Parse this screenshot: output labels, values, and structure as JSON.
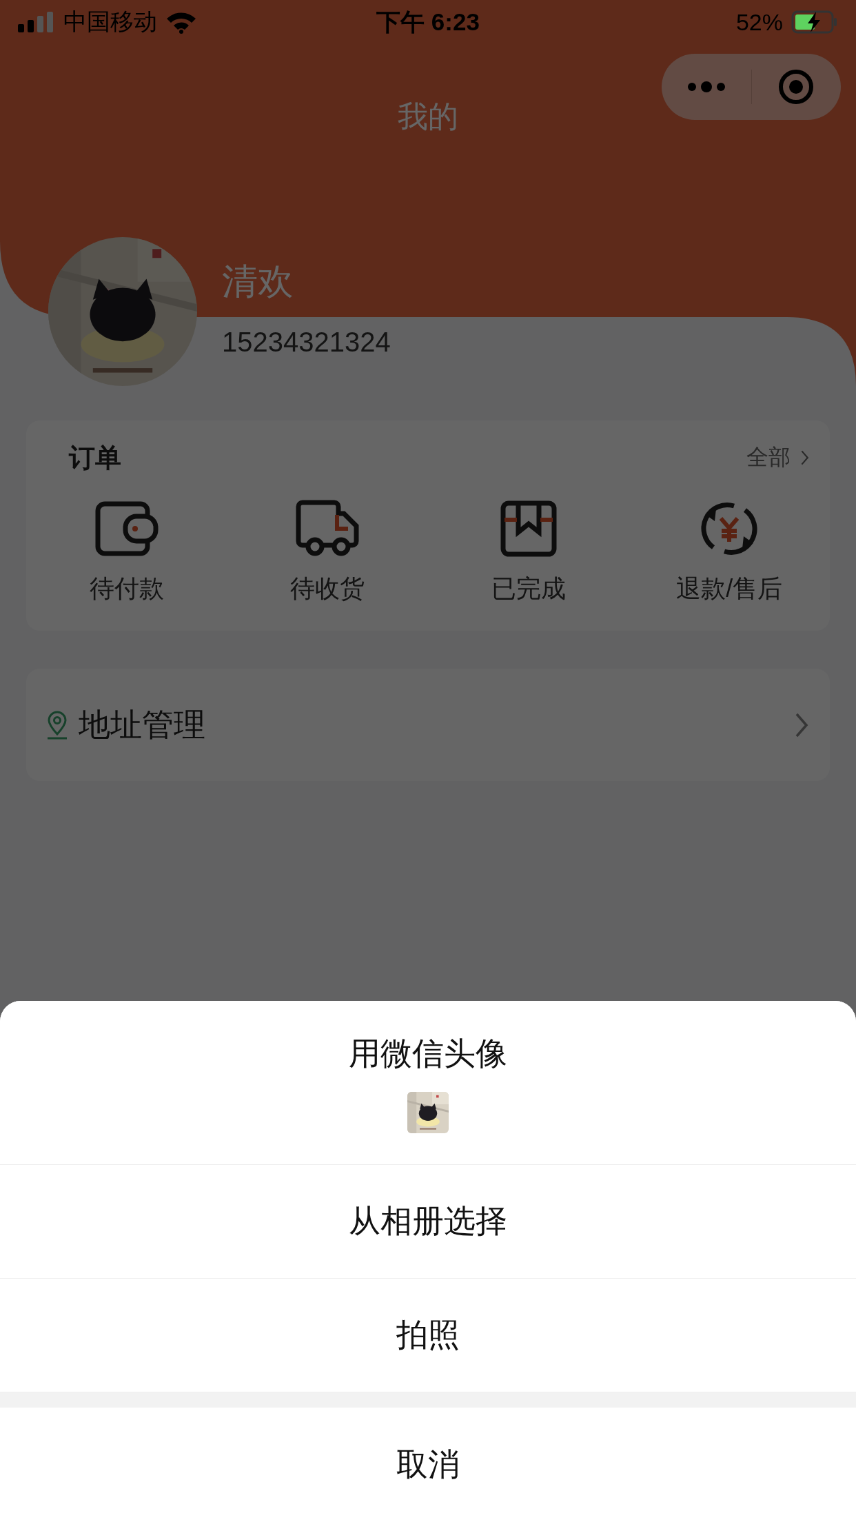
{
  "status_bar": {
    "carrier": "中国移动",
    "time": "下午 6:23",
    "battery": "52%",
    "charging": true
  },
  "nav": {
    "title": "我的"
  },
  "profile": {
    "name": "清欢",
    "phone": "15234321324"
  },
  "orders": {
    "title": "订单",
    "more": "全部",
    "items": [
      {
        "kind": "wallet",
        "label": "待付款"
      },
      {
        "kind": "truck",
        "label": "待收货"
      },
      {
        "kind": "box",
        "label": "已完成"
      },
      {
        "kind": "refund",
        "label": "退款/售后"
      }
    ]
  },
  "address": {
    "label": "地址管理"
  },
  "action_sheet": {
    "options": [
      {
        "kind": "avatar",
        "label": "用微信头像"
      },
      {
        "kind": "plain",
        "label": "从相册选择"
      },
      {
        "kind": "plain",
        "label": "拍照"
      }
    ],
    "cancel": "取消"
  }
}
